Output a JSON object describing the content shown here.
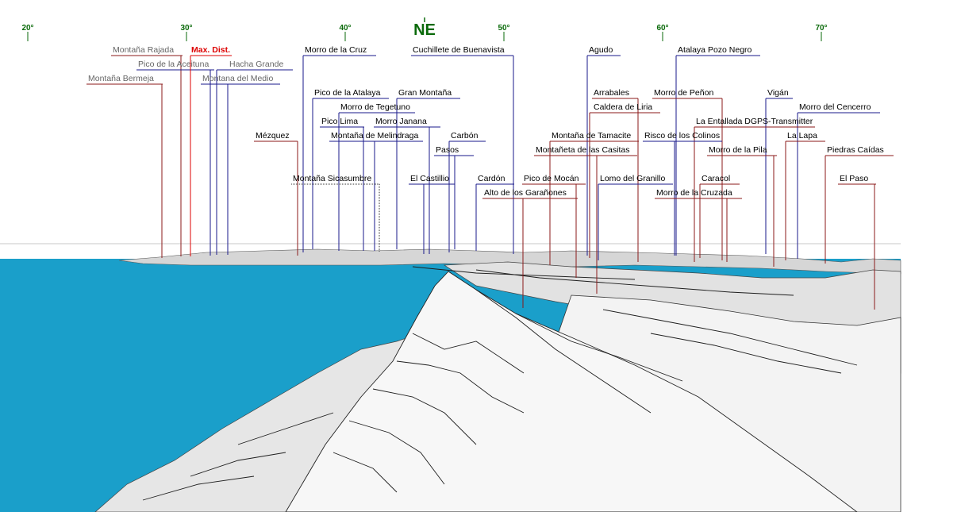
{
  "compass": {
    "direction": "NE",
    "ticks": [
      "20°",
      "30°",
      "40°",
      "50°",
      "60°",
      "70°"
    ]
  },
  "max_distance_label": "Max. Dist.",
  "colors": {
    "sea": "#1a9fca",
    "terrain": "#ececec",
    "compass": "#0a6a0a",
    "far_peak": "#8b1a1a",
    "near_peak": "#1a1a8b",
    "distant_label_text": "#666666",
    "highlight": "#dd0000"
  },
  "peaks": [
    {
      "name": "Montaña Rajada",
      "tone": "distant"
    },
    {
      "name": "Pico de la Aceituna",
      "tone": "distant"
    },
    {
      "name": "Hacha Grande",
      "tone": "distant"
    },
    {
      "name": "Montaña Bermeja",
      "tone": "distant"
    },
    {
      "name": "Montana del Medio",
      "tone": "distant"
    },
    {
      "name": "Morro de la Cruz",
      "tone": "normal"
    },
    {
      "name": "Cuchillete de Buenavista",
      "tone": "normal"
    },
    {
      "name": "Agudo",
      "tone": "normal"
    },
    {
      "name": "Atalaya Pozo Negro",
      "tone": "normal"
    },
    {
      "name": "Pico de la Atalaya",
      "tone": "normal"
    },
    {
      "name": "Gran Montaña",
      "tone": "normal"
    },
    {
      "name": "Arrabales",
      "tone": "normal"
    },
    {
      "name": "Morro de Peñon",
      "tone": "normal"
    },
    {
      "name": "Vigán",
      "tone": "normal"
    },
    {
      "name": "Morro de Tegetuno",
      "tone": "normal"
    },
    {
      "name": "Caldera de Liria",
      "tone": "normal"
    },
    {
      "name": "Morro del Cencerro",
      "tone": "normal"
    },
    {
      "name": "Pico Lima",
      "tone": "normal"
    },
    {
      "name": "Morro Janana",
      "tone": "normal"
    },
    {
      "name": "La Entallada DGPS-Transmitter",
      "tone": "normal"
    },
    {
      "name": "Mézquez",
      "tone": "normal"
    },
    {
      "name": "Montaña de Melindraga",
      "tone": "normal"
    },
    {
      "name": "Carbón",
      "tone": "normal"
    },
    {
      "name": "Montaña de Tamacite",
      "tone": "normal"
    },
    {
      "name": "Risco de los Colinos",
      "tone": "normal"
    },
    {
      "name": "La Lapa",
      "tone": "normal"
    },
    {
      "name": "Pasos",
      "tone": "normal"
    },
    {
      "name": "Montañeta de las Casitas",
      "tone": "normal"
    },
    {
      "name": "Morro de la Pila",
      "tone": "normal"
    },
    {
      "name": "Piedras Caídas",
      "tone": "normal"
    },
    {
      "name": "Montaña Sicasumbre",
      "tone": "normal"
    },
    {
      "name": "El Castillio",
      "tone": "normal"
    },
    {
      "name": "Cardón",
      "tone": "normal"
    },
    {
      "name": "Pico de Mocán",
      "tone": "normal"
    },
    {
      "name": "Lomo del Granillo",
      "tone": "normal"
    },
    {
      "name": "Caracol",
      "tone": "normal"
    },
    {
      "name": "El Paso",
      "tone": "normal"
    },
    {
      "name": "Alto de los Garañones",
      "tone": "normal"
    },
    {
      "name": "Morro de la Cruzada",
      "tone": "normal"
    }
  ]
}
